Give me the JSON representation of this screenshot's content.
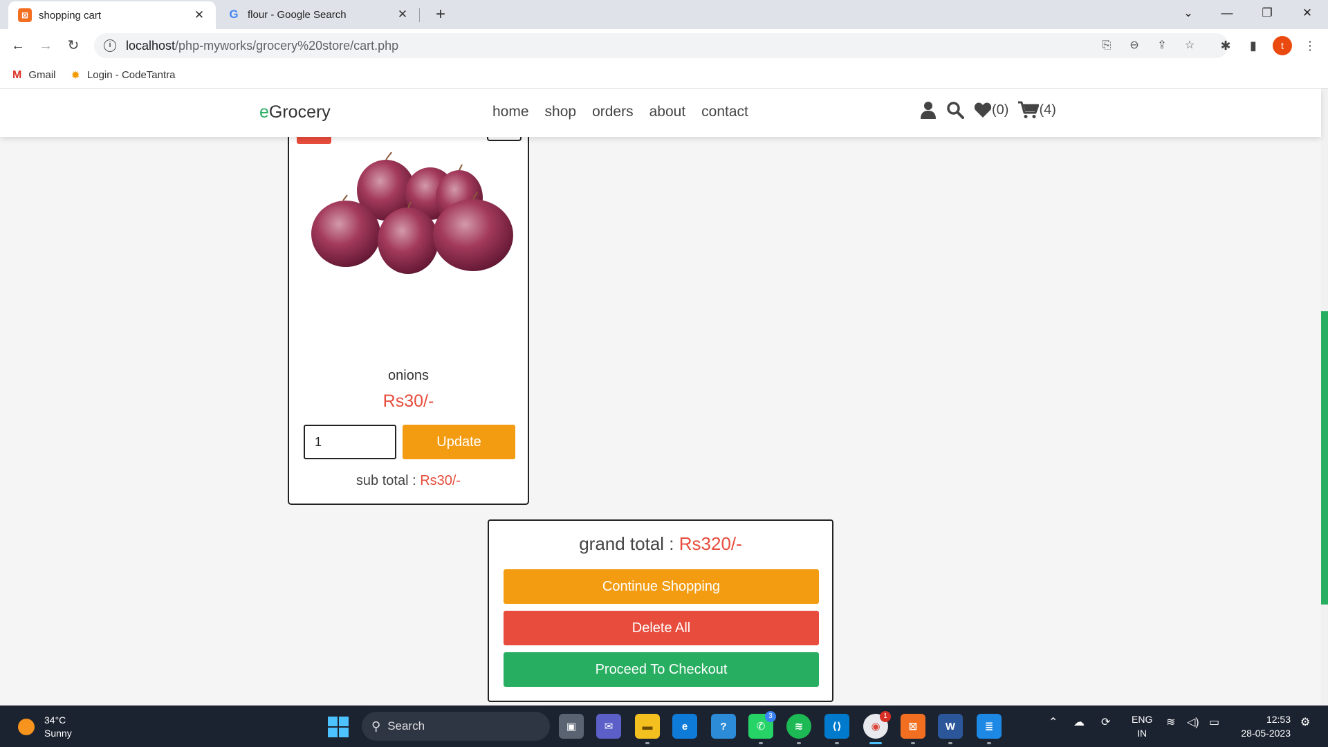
{
  "browser": {
    "tabs": [
      {
        "title": "shopping cart",
        "favicon": "xampp-icon"
      },
      {
        "title": "flour - Google Search",
        "favicon": "google-icon"
      }
    ],
    "url_host": "localhost",
    "url_path": "/php-myworks/grocery%20store/cart.php",
    "profile_initial": "t",
    "bookmarks": [
      {
        "label": "Gmail",
        "icon": "gmail-icon"
      },
      {
        "label": "Login - CodeTantra",
        "icon": "codetantra-icon"
      }
    ]
  },
  "site": {
    "logo_accent": "e",
    "logo_rest": "Grocery",
    "nav": [
      "home",
      "shop",
      "orders",
      "about",
      "contact"
    ],
    "wishlist_count": "(0)",
    "cart_count": "(4)"
  },
  "cart_item": {
    "name": "onions",
    "price": "Rs30/-",
    "quantity": "1",
    "update_label": "Update",
    "subtotal_label": "sub total :",
    "subtotal_value": "Rs30/-"
  },
  "totals": {
    "grand_label": "grand total :",
    "grand_value": "Rs320/-",
    "continue_label": "Continue Shopping",
    "delete_all_label": "Delete All",
    "checkout_label": "Proceed To Checkout"
  },
  "taskbar": {
    "temperature": "34°C",
    "condition": "Sunny",
    "search_label": "Search",
    "lang_line1": "ENG",
    "lang_line2": "IN",
    "time": "12:53",
    "date": "28-05-2023",
    "chrome_badge": "1",
    "whatsapp_badge": "3"
  },
  "colors": {
    "accent_green": "#27ae60",
    "accent_orange": "#f39c12",
    "accent_red": "#e74c3c"
  }
}
